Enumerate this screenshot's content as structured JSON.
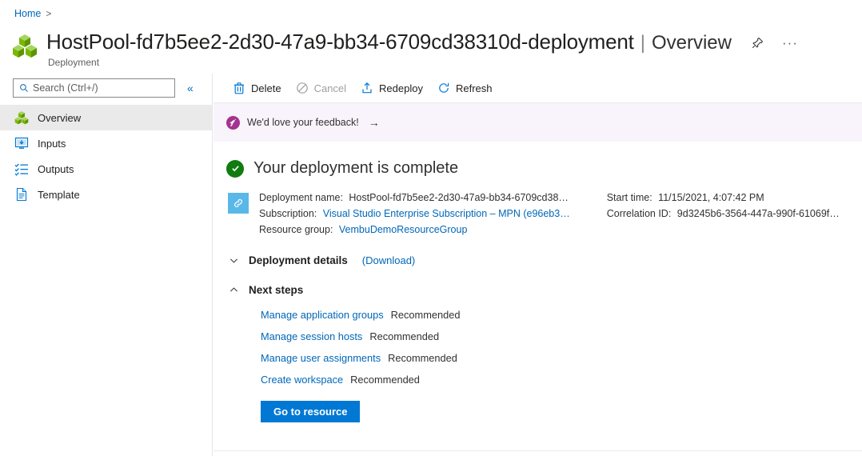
{
  "breadcrumb": {
    "home": "Home",
    "separator": ">"
  },
  "header": {
    "title": "HostPool-fd7b5ee2-2d30-47a9-bb34-6709cd38310d-deployment",
    "separator": "|",
    "page": "Overview",
    "resource_type": "Deployment",
    "pin_tooltip": "Pin to dashboard",
    "more_label": "···"
  },
  "sidebar": {
    "search": {
      "placeholder": "Search (Ctrl+/)",
      "value": ""
    },
    "collapse_label": "«",
    "items": [
      {
        "label": "Overview",
        "icon": "cubes-icon",
        "selected": true
      },
      {
        "label": "Inputs",
        "icon": "inputs-icon",
        "selected": false
      },
      {
        "label": "Outputs",
        "icon": "outputs-icon",
        "selected": false
      },
      {
        "label": "Template",
        "icon": "template-icon",
        "selected": false
      }
    ]
  },
  "toolbar": {
    "delete_label": "Delete",
    "cancel_label": "Cancel",
    "redeploy_label": "Redeploy",
    "refresh_label": "Refresh"
  },
  "feedback": {
    "text": "We'd love your feedback!",
    "arrow": "→"
  },
  "status": {
    "title": "Your deployment is complete"
  },
  "details": {
    "left": [
      {
        "label": "Deployment name:",
        "value": "HostPool-fd7b5ee2-2d30-47a9-bb34-6709cd38…",
        "link": false
      },
      {
        "label": "Subscription:",
        "value": "Visual Studio Enterprise Subscription – MPN (e96eb3…",
        "link": true
      },
      {
        "label": "Resource group:",
        "value": "VembuDemoResourceGroup",
        "link": true
      }
    ],
    "right": [
      {
        "label": "Start time:",
        "value": "11/15/2021, 4:07:42 PM",
        "link": false
      },
      {
        "label": "Correlation ID:",
        "value": "9d3245b6-3564-447a-990f-61069f…",
        "link": false
      }
    ]
  },
  "sections": {
    "deployment_details": {
      "title": "Deployment details",
      "extra": "(Download)",
      "expanded": false
    },
    "next_steps": {
      "title": "Next steps",
      "expanded": true
    }
  },
  "next_steps": [
    {
      "link": "Manage application groups",
      "tag": "Recommended"
    },
    {
      "link": "Manage session hosts",
      "tag": "Recommended"
    },
    {
      "link": "Manage user assignments",
      "tag": "Recommended"
    },
    {
      "link": "Create workspace",
      "tag": "Recommended"
    }
  ],
  "actions": {
    "go_to_resource": "Go to resource"
  },
  "colors": {
    "link": "#0067b8",
    "primary_button": "#0078d4",
    "success": "#107c10",
    "feedback_accent": "#a4338f",
    "selected_row": "#eaeaea"
  }
}
